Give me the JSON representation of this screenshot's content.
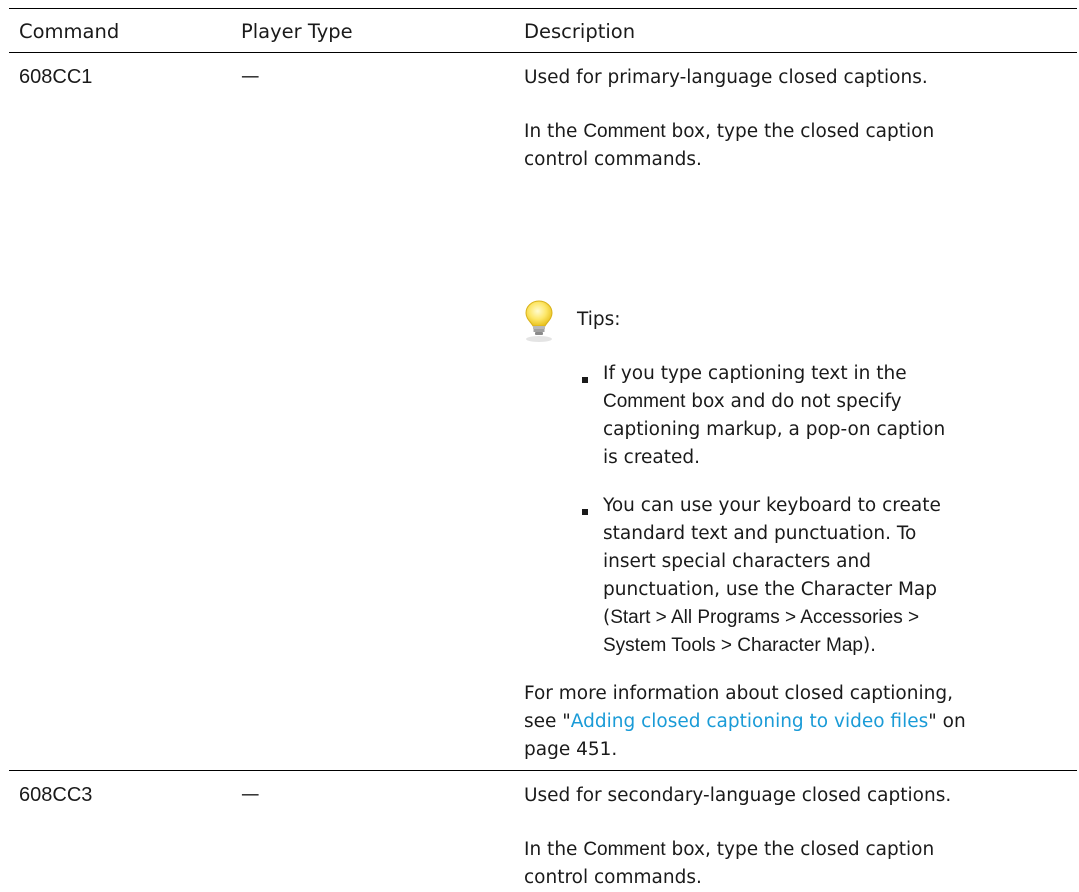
{
  "table": {
    "headers": {
      "command": "Command",
      "player_type": "Player Type",
      "description": "Description"
    },
    "rows": [
      {
        "command": "608CC1",
        "player_type": "—",
        "desc_line_1": "Used for primary-language closed captions.",
        "comment_pre": "In the ",
        "comment_ui": "Comment",
        "comment_post": " box, type the closed caption",
        "comment_line_2": "control commands.",
        "tips_label": "Tips:",
        "tip_1": {
          "line_1": "If you type captioning text in the",
          "ui": "Comment",
          "line_2_post": " box and do not specify",
          "line_3": "captioning markup, a pop-on caption",
          "line_4": "is created."
        },
        "tip_2": {
          "line_1": "You can use your keyboard to create",
          "line_2": "standard text and punctuation. To",
          "line_3": "insert special characters and",
          "line_4": "punctuation, use the Character Map",
          "path_open": "(",
          "path_1": "Start > All Programs > Accessories >",
          "path_2": "System Tools > Character Map",
          "path_close": ")."
        },
        "more_info_line_1": "For more information about closed captioning,",
        "more_info_pre": "see \"",
        "more_info_link": "Adding closed captioning to video files",
        "more_info_post": "\" on",
        "more_info_line_3": "page 451."
      },
      {
        "command": "608CC3",
        "player_type": "—",
        "desc_line_1": "Used for secondary-language closed captions.",
        "comment_pre": "In the ",
        "comment_ui": "Comment",
        "comment_post": " box, type the closed caption",
        "comment_line_2": "control commands."
      }
    ]
  },
  "colors": {
    "link": "#1a9bd7",
    "text": "#1a1a1a",
    "rule": "#000000"
  },
  "icons": {
    "tip": "lightbulb-icon",
    "bullet": "square-bullet-icon"
  }
}
